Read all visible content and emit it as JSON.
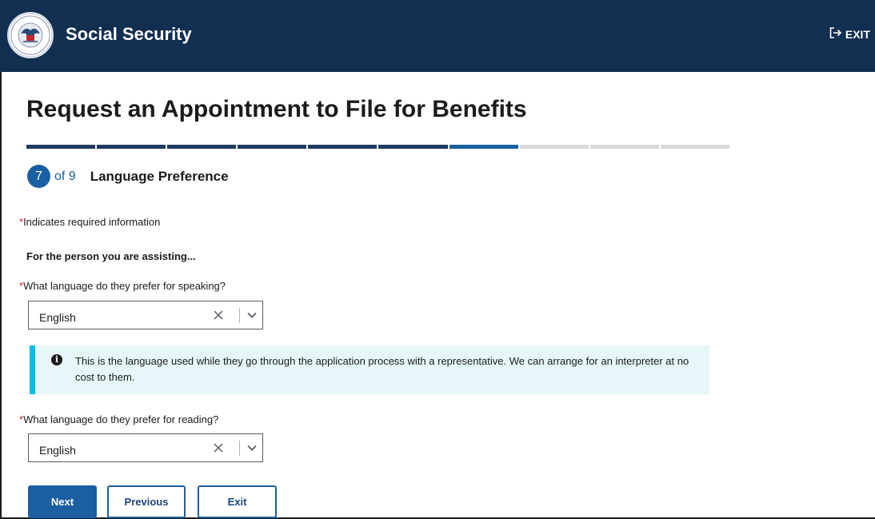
{
  "header": {
    "brand": "Social Security",
    "exit_label": "EXIT",
    "logo_text": "SOCIAL SECURITY ADMINISTRATION USA"
  },
  "page": {
    "title": "Request an Appointment to File for Benefits"
  },
  "progress": {
    "current_step": "7",
    "total_label": "of 9",
    "total_steps": 9,
    "step_title": "Language Preference"
  },
  "form": {
    "required_star": "*",
    "required_note": "Indicates required information",
    "assisting_heading": "For the person you are assisting...",
    "speaking": {
      "label": "What language do they prefer for speaking?",
      "value": "English"
    },
    "info_alert": "This is the language used while they go through the application process with a representative. We can arrange for an interpreter at no cost to them.",
    "reading": {
      "label": "What language do they prefer for reading?",
      "value": "English"
    }
  },
  "buttons": {
    "next": "Next",
    "previous": "Previous",
    "exit": "Exit"
  },
  "colors": {
    "header_bg": "#122e51",
    "primary": "#1a5fa1",
    "progress_done": "#1f3a5f",
    "required": "#c0262e",
    "alert_bg": "#e7f6f8",
    "alert_border": "#00bde3"
  },
  "icons": {
    "exit": "exit-arrow-icon",
    "info": "info-icon",
    "clear": "close-icon",
    "dropdown": "chevron-down-icon"
  }
}
